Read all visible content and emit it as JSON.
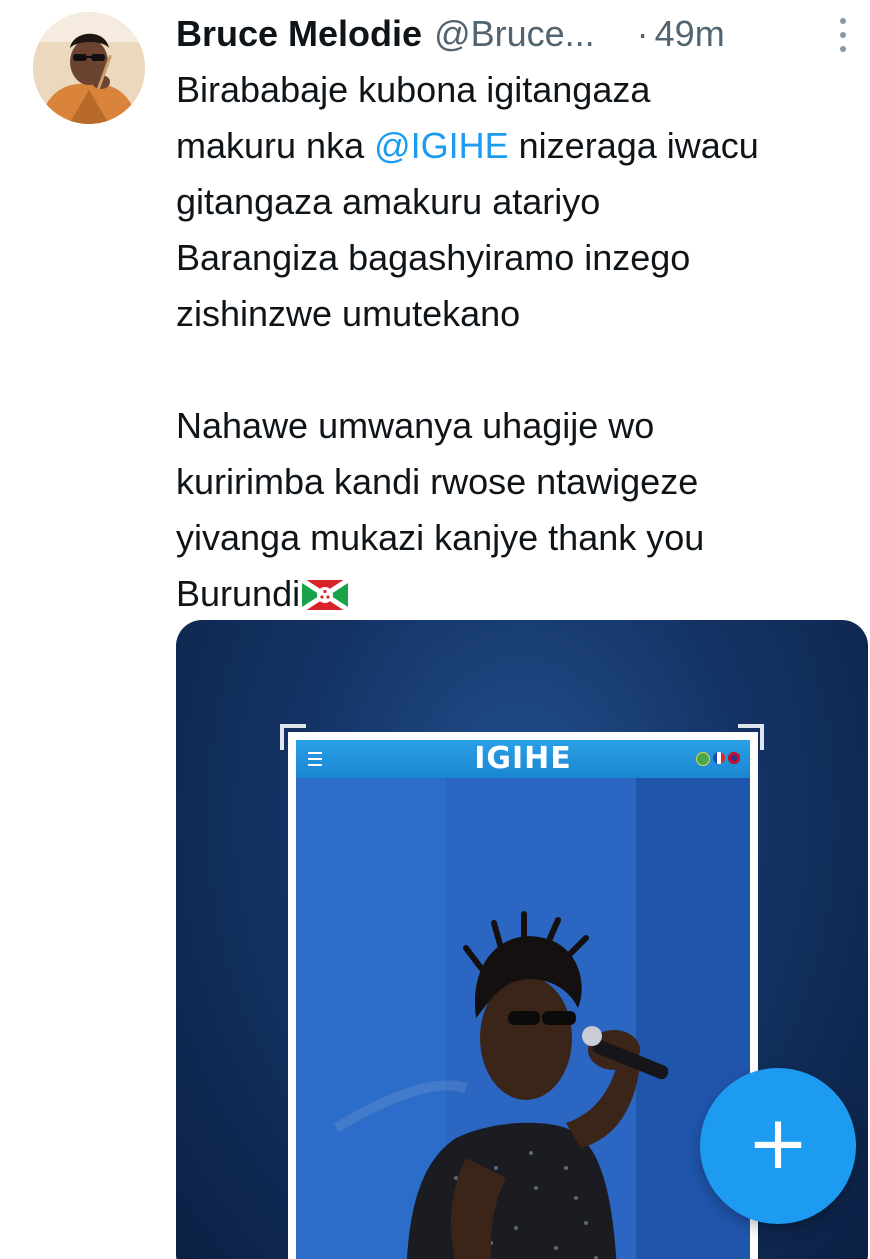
{
  "tweet": {
    "display_name": "Bruce Melodie",
    "handle": "@Bruce...",
    "separator": "·",
    "time": "49m",
    "more_icon": "more-vertical-icon",
    "paragraph1_a": "Birababaje kubona igitangaza\nmakuru nka ",
    "mention": "@IGIHE",
    "paragraph1_b": "  nizeraga iwacu\ngitangaza amakuru atariyo\nBarangiza bagashyiramo inzego\nzishinzwe umutekano",
    "paragraph2": "Nahawe umwanya uhagije wo\nkuririmba kandi rwose ntawigeze\nyivanga mukazi kanjye  thank you\nBurundi",
    "flag_icon": "burundi-flag-icon"
  },
  "media": {
    "site_logo": "IGIHE",
    "menu_icon": "hamburger-menu-icon",
    "language_icons": [
      "kinyarwanda-flag-icon",
      "french-flag-icon",
      "uk-flag-icon"
    ]
  },
  "fab": {
    "label": "+",
    "icon": "plus-icon",
    "color": "#1d9bf0"
  },
  "colors": {
    "text": "#0f1419",
    "secondary": "#536471",
    "link": "#1d9bf0"
  }
}
